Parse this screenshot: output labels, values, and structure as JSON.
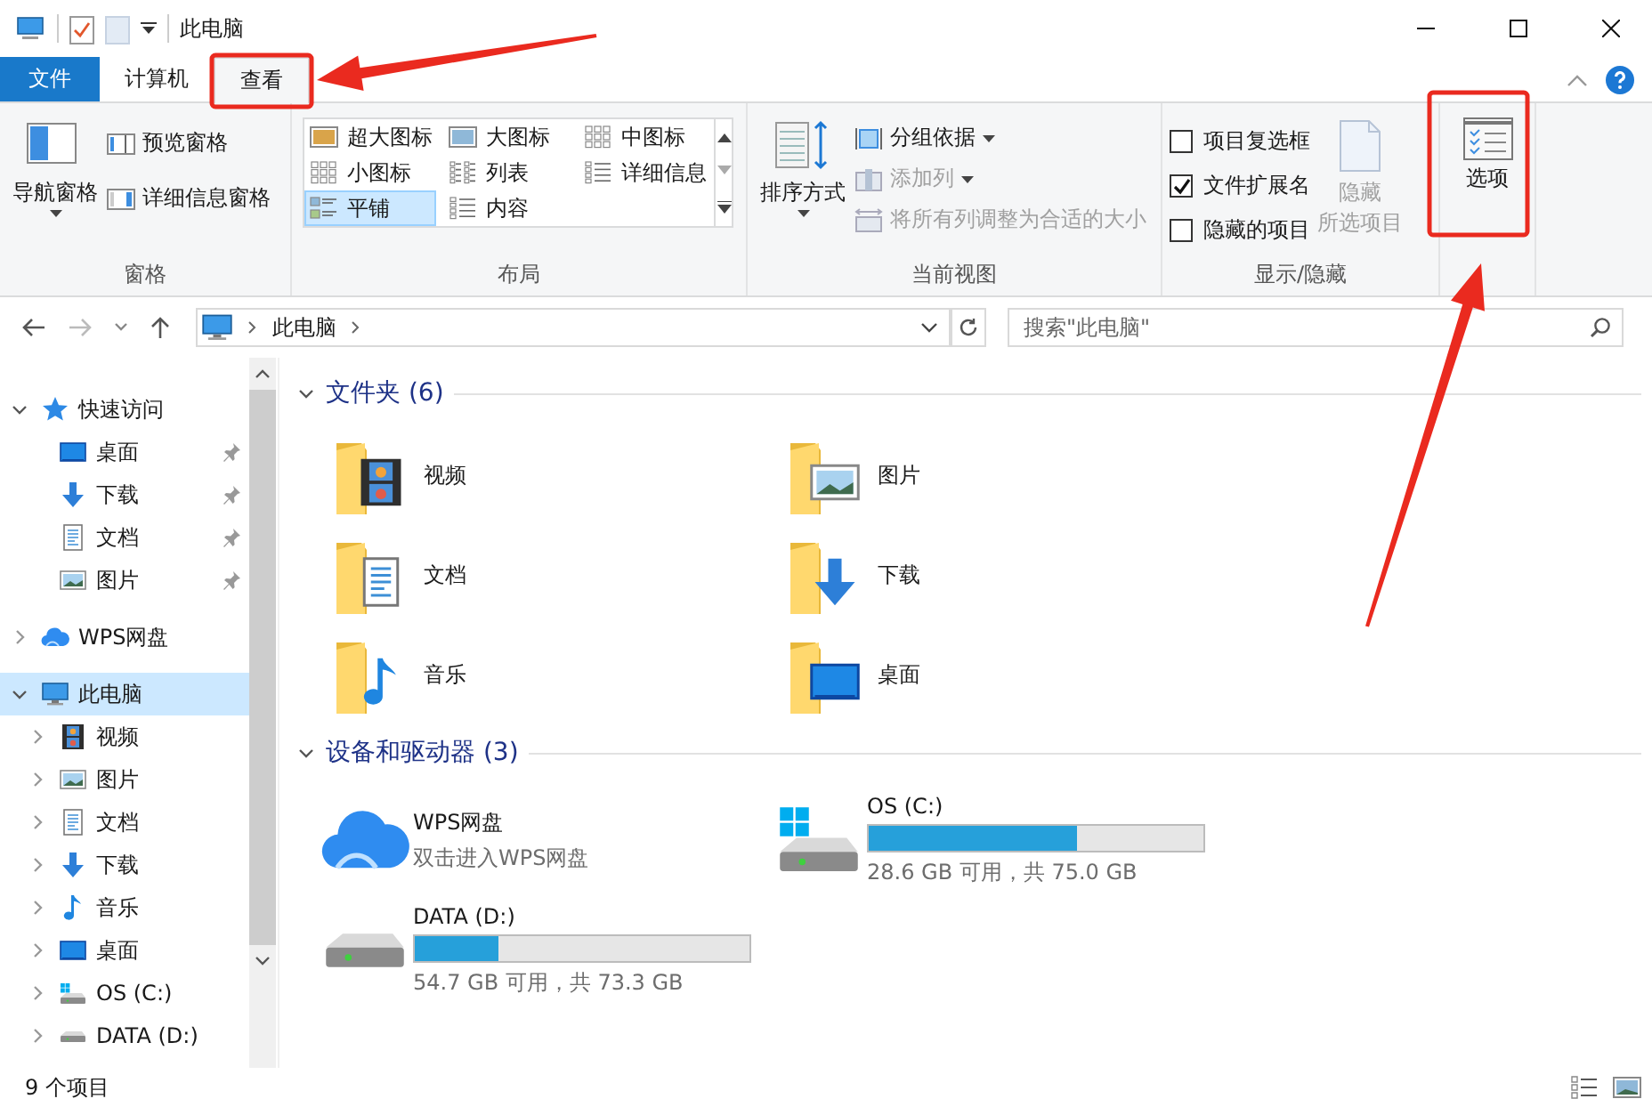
{
  "title_bar": {
    "title": "此电脑"
  },
  "ribbon_tabs": [
    {
      "label": "文件",
      "kind": "file",
      "selected": false
    },
    {
      "label": "计算机",
      "kind": "tab",
      "selected": false
    },
    {
      "label": "查看",
      "kind": "tab",
      "selected": true
    }
  ],
  "ribbon": {
    "panes": {
      "group": "窗格",
      "nav_pane": "导航窗格",
      "preview_pane": "预览窗格",
      "details_pane": "详细信息窗格"
    },
    "layout": {
      "group": "布局",
      "options": [
        {
          "label": "超大图标",
          "kind": "extra_large",
          "selected": false
        },
        {
          "label": "大图标",
          "kind": "large",
          "selected": false
        },
        {
          "label": "中图标",
          "kind": "medium",
          "selected": false
        },
        {
          "label": "小图标",
          "kind": "small",
          "selected": false
        },
        {
          "label": "列表",
          "kind": "list",
          "selected": false
        },
        {
          "label": "详细信息",
          "kind": "details",
          "selected": false
        },
        {
          "label": "平铺",
          "kind": "tiles",
          "selected": true
        },
        {
          "label": "内容",
          "kind": "content",
          "selected": false
        }
      ]
    },
    "current_view": {
      "group": "当前视图",
      "sort": "排序方式",
      "group_by": {
        "label": "分组依据",
        "disabled": false
      },
      "add_column": {
        "label": "添加列",
        "disabled": true
      },
      "fit_columns": {
        "label": "将所有列调整为合适的大小",
        "disabled": true
      }
    },
    "show_hide": {
      "group": "显示/隐藏",
      "checkboxes": [
        {
          "label": "项目复选框",
          "checked": false
        },
        {
          "label": "文件扩展名",
          "checked": true
        },
        {
          "label": "隐藏的项目",
          "checked": false
        }
      ],
      "hide_selected": {
        "label_lines": [
          "隐藏",
          "所选项目"
        ],
        "disabled": true
      }
    },
    "options": {
      "label": "选项"
    }
  },
  "address_bar": {
    "path": "此电脑",
    "search_placeholder": "搜索\"此电脑\""
  },
  "sidebar": {
    "items": [
      {
        "label": "快速访问",
        "kind": "star",
        "expanded": true,
        "selected": false,
        "children": [
          {
            "label": "桌面",
            "kind": "desktop",
            "pinned": true,
            "selected": false
          },
          {
            "label": "下载",
            "kind": "downloads",
            "pinned": true,
            "selected": false
          },
          {
            "label": "文档",
            "kind": "documents",
            "pinned": true,
            "selected": false
          },
          {
            "label": "图片",
            "kind": "pictures",
            "pinned": true,
            "selected": false
          }
        ]
      },
      {
        "label": "WPS网盘",
        "kind": "cloud",
        "expanded": false,
        "selected": false
      },
      {
        "label": "此电脑",
        "kind": "computer",
        "expanded": true,
        "selected": true,
        "children": [
          {
            "label": "视频",
            "kind": "videos",
            "expanded": false,
            "selected": false
          },
          {
            "label": "图片",
            "kind": "pictures",
            "expanded": false,
            "selected": false
          },
          {
            "label": "文档",
            "kind": "documents",
            "expanded": false,
            "selected": false
          },
          {
            "label": "下载",
            "kind": "downloads",
            "expanded": false,
            "selected": false
          },
          {
            "label": "音乐",
            "kind": "music",
            "expanded": false,
            "selected": false
          },
          {
            "label": "桌面",
            "kind": "desktop",
            "expanded": false,
            "selected": false
          },
          {
            "label": "OS (C:)",
            "kind": "system_drive",
            "expanded": false,
            "selected": false
          },
          {
            "label": "DATA (D:)",
            "kind": "drive",
            "expanded": false,
            "selected": false
          }
        ]
      }
    ]
  },
  "sections": [
    {
      "title": "文件夹 (6)",
      "kind": "folders",
      "expanded": true,
      "items": [
        {
          "name": "视频",
          "kind": "videos"
        },
        {
          "name": "图片",
          "kind": "pictures"
        },
        {
          "name": "文档",
          "kind": "documents"
        },
        {
          "name": "下载",
          "kind": "downloads"
        },
        {
          "name": "音乐",
          "kind": "music"
        },
        {
          "name": "桌面",
          "kind": "desktop"
        }
      ]
    },
    {
      "title": "设备和驱动器 (3)",
      "kind": "devices",
      "expanded": true,
      "items": [
        {
          "name": "WPS网盘",
          "kind": "cloud",
          "subtitle": "双击进入WPS网盘"
        },
        {
          "name": "OS (C:)",
          "kind": "system_drive",
          "level": 0.62,
          "reading": "28.6 GB 可用，共 75.0 GB"
        },
        {
          "name": "DATA (D:)",
          "kind": "drive",
          "level": 0.25,
          "reading": "54.7 GB 可用，共 73.3 GB"
        }
      ]
    }
  ],
  "status_bar": {
    "count": "9 个项目"
  }
}
